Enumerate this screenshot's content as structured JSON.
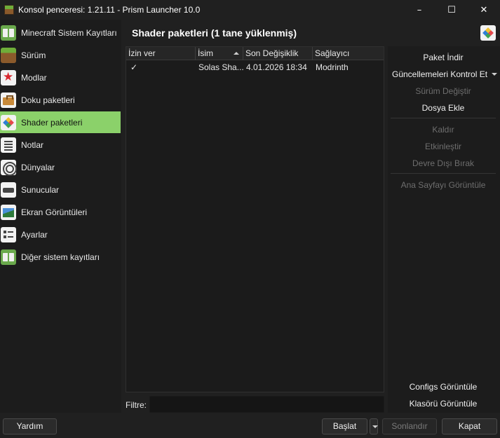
{
  "window": {
    "title": "Konsol penceresi: 1.21.11 - Prism Launcher 10.0",
    "controls": [
      "–",
      "☐",
      "✕"
    ]
  },
  "sidebar": {
    "items": [
      {
        "label": "Minecraft Sistem Kayıtları",
        "icon": "book-icon",
        "active": false
      },
      {
        "label": "Sürüm",
        "icon": "grass-block-icon",
        "active": false
      },
      {
        "label": "Modlar",
        "icon": "star-icon",
        "active": false
      },
      {
        "label": "Doku paketleri",
        "icon": "resource-pack-icon",
        "active": false
      },
      {
        "label": "Shader paketleri",
        "icon": "shader-cube-icon",
        "active": true
      },
      {
        "label": "Notlar",
        "icon": "notes-icon",
        "active": false
      },
      {
        "label": "Dünyalar",
        "icon": "worlds-icon",
        "active": false
      },
      {
        "label": "Sunucular",
        "icon": "server-icon",
        "active": false
      },
      {
        "label": "Ekran Görüntüleri",
        "icon": "screenshot-icon",
        "active": false
      },
      {
        "label": "Ayarlar",
        "icon": "settings-icon",
        "active": false
      },
      {
        "label": "Diğer sistem kayıtları",
        "icon": "book-icon",
        "active": false
      }
    ]
  },
  "main": {
    "title": "Shader paketleri (1 tane yüklenmiş)",
    "table": {
      "columns": [
        "İzin ver",
        "İsim",
        "Son Değişiklik",
        "Sağlayıcı"
      ],
      "rows": [
        {
          "enabled": "✓",
          "name": "Solas Sha...",
          "modified": "4.01.2026 18:34",
          "provider": "Modrinth"
        }
      ]
    },
    "filter": {
      "label": "Filtre:",
      "value": ""
    }
  },
  "actions": {
    "download": "Paket İndir",
    "check_updates": "Güncellemeleri Kontrol Et",
    "change_version": "Sürüm Değiştir",
    "add_file": "Dosya Ekle",
    "remove": "Kaldır",
    "enable": "Etkinleştir",
    "disable": "Devre Dışı Bırak",
    "homepage": "Ana Sayfayı Görüntüle",
    "view_configs": "Configs Görüntüle",
    "view_folder": "Klasörü Görüntüle"
  },
  "bottom": {
    "help": "Yardım",
    "launch": "Başlat",
    "kill": "Sonlandır",
    "close": "Kapat"
  }
}
